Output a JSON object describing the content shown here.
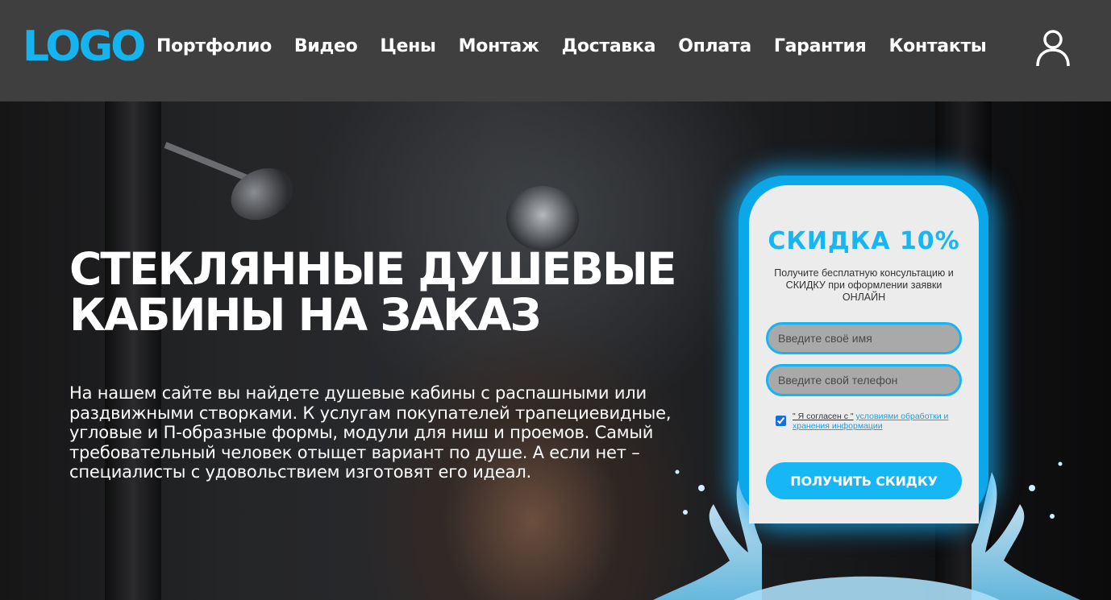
{
  "header": {
    "logo": "LOGO",
    "nav": [
      "Портфолио",
      "Видео",
      "Цены",
      "Монтаж",
      "Доставка",
      "Оплата",
      "Гарантия",
      "Контакты"
    ],
    "user_icon": "user-icon"
  },
  "hero": {
    "title": "Стеклянные душевые кабины на заказ",
    "text": "На нашем сайте вы найдете душевые кабины с распашными или раздвижными створками. К услугам покупателей трапециевидные, угловые и П-образные формы, модули для ниш и проемов. Самый требовательный человек отыщет вариант по душе. А если нет – специалисты с удовольствием изготовят его идеал."
  },
  "form": {
    "title": "СКИДКА 10%",
    "subtitle": "Получите бесплатную консультацию и СКИДКУ при оформлении заявки ОНЛАЙН",
    "name_placeholder": "Введите своё имя",
    "phone_placeholder": "Введите свой телефон",
    "agree_prefix": "\" Я согласен с \"",
    "agree_link": "условиями обработки и хранения информации",
    "agree_checked": true,
    "submit_label": "ПОЛУЧИТЬ СКИДКУ"
  },
  "colors": {
    "accent": "#17b6f4",
    "header_bg": "#3f3f3f",
    "card_bg": "#ececec"
  }
}
